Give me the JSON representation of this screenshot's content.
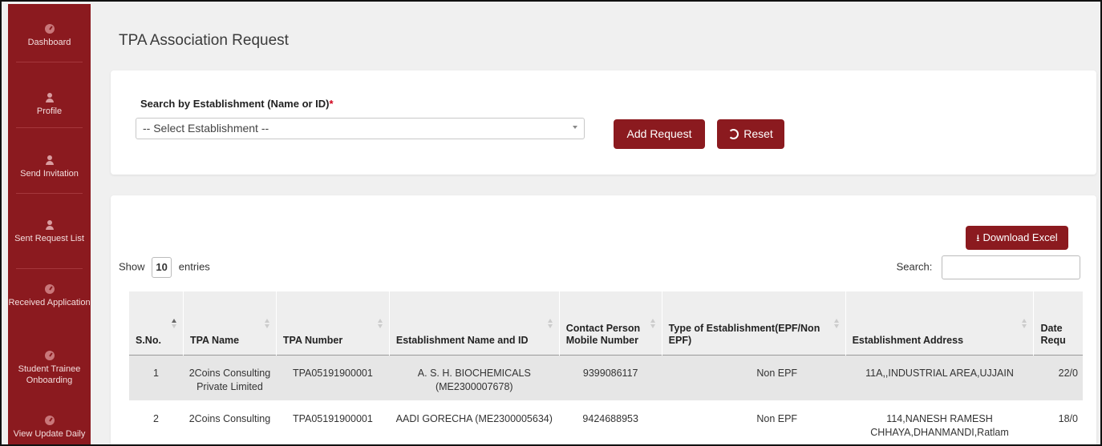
{
  "sidebar": {
    "items": [
      {
        "label": "Dashboard",
        "icon": "gauge-icon"
      },
      {
        "label": "Profile",
        "icon": "user-icon"
      },
      {
        "label": "Send Invitation",
        "icon": "user-icon"
      },
      {
        "label": "Sent Request List",
        "icon": "user-icon"
      },
      {
        "label": "Received Application",
        "icon": "gauge-icon"
      },
      {
        "label": "Student Trainee Onboarding",
        "icon": "gauge-icon"
      },
      {
        "label": "View Update Daily",
        "icon": "gauge-icon"
      }
    ]
  },
  "page": {
    "title": "TPA Association Request"
  },
  "search": {
    "label": "Search by Establishment (Name or ID)",
    "required_mark": "*",
    "select_value": "-- Select Establishment --",
    "add_button": "Add Request",
    "reset_button": "Reset"
  },
  "table_controls": {
    "download_button": "Download Excel",
    "show_label": "Show",
    "entries_value": "10",
    "entries_label": "entries",
    "search_label": "Search:"
  },
  "table": {
    "headers": [
      "S.No.",
      "TPA Name",
      "TPA Number",
      "Establishment Name and ID",
      "Contact Person Mobile Number",
      "Type of Establishment(EPF/Non EPF)",
      "Establishment Address",
      "Date Requ"
    ],
    "rows": [
      [
        "1",
        "2Coins Consulting Private Limited",
        "TPA05191900001",
        "A. S. H. BIOCHEMICALS (ME2300007678)",
        "9399086117",
        "Non EPF",
        "11A,,INDUSTRIAL AREA,UJJAIN",
        "22/0"
      ],
      [
        "2",
        "2Coins Consulting",
        "TPA05191900001",
        "AADI GORECHA (ME2300005634)",
        "9424688953",
        "Non EPF",
        "114,NANESH RAMESH CHHAYA,DHANMANDI,Ratlam",
        "18/0"
      ]
    ]
  },
  "colors": {
    "brand": "#8b1a1f",
    "background": "#f0f0f0"
  }
}
